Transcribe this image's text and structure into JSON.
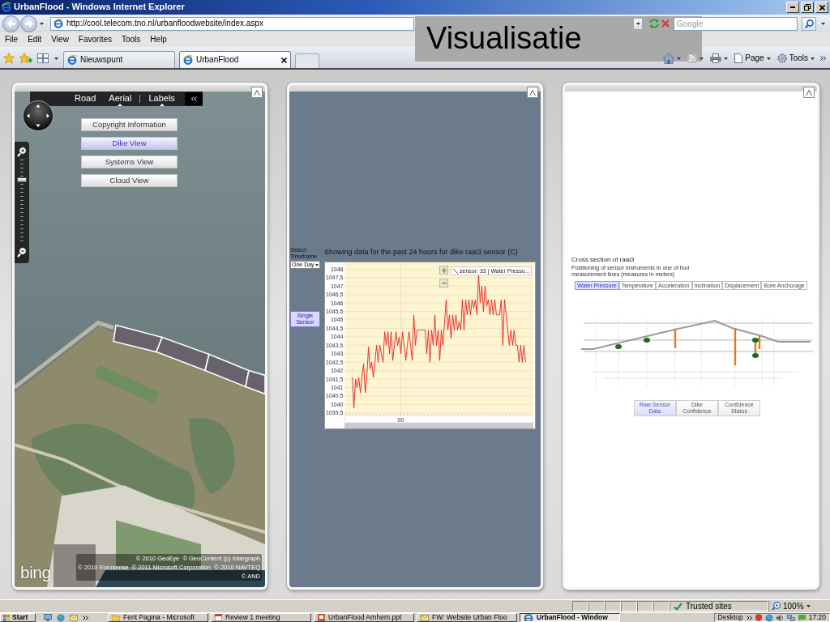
{
  "window": {
    "title": "UrbanFlood - Windows Internet Explorer"
  },
  "address_bar": {
    "url": "http://cool.telecom.tno.nl/urbanfloodwebsite/index.aspx"
  },
  "search": {
    "placeholder": "Google"
  },
  "menu": [
    "File",
    "Edit",
    "View",
    "Favorites",
    "Tools",
    "Help"
  ],
  "tabs": [
    {
      "label": "Nieuwspunt",
      "selected": false
    },
    {
      "label": "UrbanFlood",
      "selected": true
    }
  ],
  "command_bar": [
    {
      "kind": "home"
    },
    {
      "kind": "feeds"
    },
    {
      "kind": "print"
    },
    {
      "kind": "page",
      "label": "Page"
    },
    {
      "kind": "tools",
      "label": "Tools"
    }
  ],
  "slide_title": "Visualisatie",
  "map_panel": {
    "map_types": [
      {
        "label": "Road",
        "selected": false
      },
      {
        "label": "Aerial",
        "selected": true
      }
    ],
    "labels_toggle": {
      "label": "Labels",
      "on": true
    },
    "zoom_slider": {
      "level": 0.78
    },
    "views": [
      {
        "label": "Copyright Information",
        "selected": false
      },
      {
        "label": "Dike View",
        "selected": true
      },
      {
        "label": "Systems View",
        "selected": false
      },
      {
        "label": "Cloud View",
        "selected": false
      }
    ],
    "logo": "bing",
    "copyright": [
      "© 2010 GeoEye  © GeoContent (p) Intergraph",
      "© 2010 Eurosense  © 2011 Microsoft Corporation  © 2010 NAVTEQ",
      "© AND"
    ]
  },
  "chart_panel": {
    "timeframe": {
      "label": "Select Timeframe",
      "value": "One Day"
    },
    "sensor_button": "Single Sensor",
    "title": "Showing data for the past 24 hours for dike raai3 sensor (C)",
    "chart_data": {
      "type": "line",
      "grid": true,
      "series": [
        {
          "name": "sensor: 33 | Water Pressu...",
          "color": "#e41e1e",
          "values": [
            1041.6,
            1039.8,
            1041.5,
            1041.0,
            1041.6,
            1040.7,
            1041.7,
            1042.4,
            1040.7,
            1041.6,
            1043.4,
            1042.1,
            1042.5,
            1041.6,
            1042.5,
            1043.5,
            1042.5,
            1043.5,
            1043.0,
            1042.5,
            1044.3,
            1043.5,
            1044.3,
            1043.0,
            1044.3,
            1042.6,
            1043.5,
            1044.3,
            1043.5,
            1044.0,
            1043.0,
            1044.3,
            1043.5,
            1042.6,
            1043.5,
            1044.3,
            1043.5,
            1042.6,
            1045.3,
            1043.5,
            1044.4,
            1044.4,
            1044.4,
            1044.4,
            1044.4,
            1044.4,
            1043.0,
            1044.4,
            1042.5,
            1044.4,
            1043.5,
            1045.3,
            1043.5,
            1044.4,
            1042.6,
            1044.4,
            1043.5,
            1044.9,
            1046.2,
            1044.4,
            1045.3,
            1043.9,
            1045.3,
            1044.4,
            1045.3,
            1044.4,
            1044.9,
            1044.4,
            1046.2,
            1044.4,
            1046.2,
            1045.3,
            1046.2,
            1045.3,
            1046.2,
            1045.7,
            1046.2,
            1045.3,
            1047.7,
            1046.0,
            1047.0,
            1045.5,
            1047.0,
            1045.8,
            1046.2,
            1045.3,
            1046.2,
            1045.3,
            1046.2,
            1045.3,
            1045.3,
            1045.3,
            1046.2,
            1043.5,
            1046.2,
            1045.3,
            1044.4,
            1043.5,
            1044.4,
            1043.5,
            1044.4,
            1043.5,
            1043.5,
            1042.5,
            1043.5,
            1042.5,
            1043.5,
            1042.5
          ]
        }
      ],
      "ylim": [
        1039.4,
        1048.4
      ],
      "yticks": [
        {
          "value": 1048,
          "label": "1048"
        },
        {
          "value": 1047.5,
          "label": "1047,5"
        },
        {
          "value": 1047,
          "label": "1047"
        },
        {
          "value": 1046.5,
          "label": "1046,5"
        },
        {
          "value": 1046,
          "label": "1046"
        },
        {
          "value": 1045.5,
          "label": "1045,5"
        },
        {
          "value": 1045,
          "label": "1045"
        },
        {
          "value": 1044.5,
          "label": "1044,5"
        },
        {
          "value": 1044,
          "label": "1044"
        },
        {
          "value": 1043.5,
          "label": "1043,5"
        },
        {
          "value": 1043,
          "label": "1043"
        },
        {
          "value": 1042.5,
          "label": "1042,5"
        },
        {
          "value": 1042,
          "label": "1042"
        },
        {
          "value": 1041.5,
          "label": "1041,5"
        },
        {
          "value": 1041,
          "label": "1041"
        },
        {
          "value": 1040.5,
          "label": "1040,5"
        },
        {
          "value": 1040,
          "label": "1040"
        },
        {
          "value": 1039.5,
          "label": "1039,5"
        }
      ],
      "annotations": [
        "00"
      ]
    }
  },
  "cross_section_panel": {
    "title": "Cross section of raai3",
    "subtitle": "Positioning of sensor instruments in one of four measurement lines (measures in meters)",
    "tabs": [
      {
        "label": "Water Pressure",
        "selected": true
      },
      {
        "label": "Temperature",
        "selected": false
      },
      {
        "label": "Acceleration",
        "selected": false
      },
      {
        "label": "Inclination",
        "selected": false
      },
      {
        "label": "Displacement",
        "selected": false
      },
      {
        "label": "Bore Anchorage",
        "selected": false
      }
    ],
    "buttons": [
      {
        "label": "Raw Sensor Data",
        "selected": true
      },
      {
        "label": "Dike Confidence",
        "selected": false
      },
      {
        "label": "Confidence Status",
        "selected": false
      }
    ]
  },
  "status_bar": {
    "zone": "Trusted sites",
    "zoom": "100%"
  },
  "taskbar": {
    "start": "Start",
    "tasks": [
      {
        "kind": "folder",
        "label": "Fent Pagina - Microsoft",
        "selected": false
      },
      {
        "kind": "calendar",
        "label": "Review 1 meeting",
        "selected": false
      },
      {
        "kind": "presentation",
        "label": "UrbanFlood Arnhem.ppt",
        "selected": false
      },
      {
        "kind": "mail",
        "label": "FW: Website Urban Floo",
        "selected": false
      },
      {
        "kind": "browser",
        "label": "UrbanFlood - Window",
        "selected": true
      }
    ],
    "desktop": "Desktop",
    "clock": "17:20"
  }
}
